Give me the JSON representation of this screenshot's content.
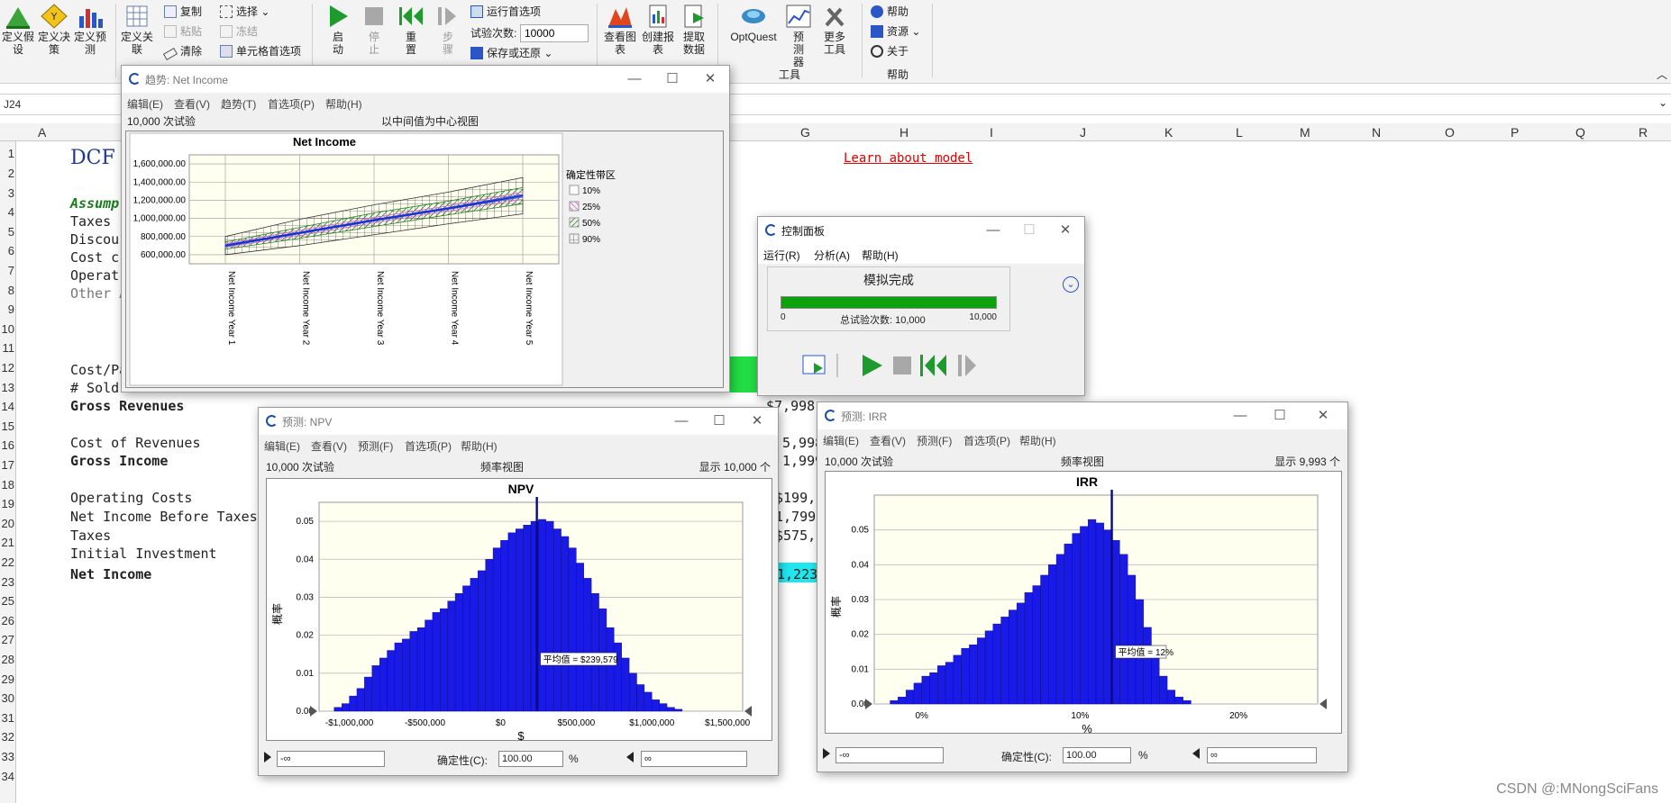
{
  "ribbon": {
    "define_assumption": "定义假设",
    "define_decision": "定义决策",
    "define_forecast": "定义预测",
    "define_correlation": "定义关联",
    "copy": "复制",
    "paste": "粘贴",
    "clear": "清除",
    "select": "选择",
    "freeze": "冻结",
    "cell_prefs": "单元格首选项",
    "start": "启动",
    "stop": "停止",
    "reset": "重置",
    "step": "步骤",
    "run_prefs": "运行首选项",
    "trials_label": "试验次数:",
    "trials_value": "10000",
    "save_restore": "保存或还原",
    "view_charts": "查看图表",
    "create_report": "创建报表",
    "extract_data": "提取数据",
    "optquest": "OptQuest",
    "predictor": "预测器",
    "more_tools": "更多工具",
    "tools_group": "工具",
    "help": "帮助",
    "resources": "资源",
    "about": "关于",
    "help_group": "帮助"
  },
  "formula_bar": {
    "name_box": "J24"
  },
  "columns": [
    "A",
    "G",
    "H",
    "I",
    "J",
    "K",
    "L",
    "M",
    "N",
    "O",
    "P",
    "Q",
    "R"
  ],
  "rows": [
    "1",
    "2",
    "3",
    "4",
    "5",
    "6",
    "7",
    "8",
    "9",
    "10",
    "11",
    "12",
    "13",
    "14",
    "15",
    "16",
    "17",
    "18",
    "19",
    "20",
    "21",
    "22",
    "23",
    "25",
    "26",
    "27",
    "28",
    "29",
    "30",
    "31",
    "32",
    "33",
    "34"
  ],
  "sheet": {
    "title": "DCF",
    "learn_link": "Learn about model",
    "assump": "Assump",
    "taxes": "Taxes",
    "discou": "Discou",
    "cost_c": "Cost c",
    "operat": "Operat",
    "other": "Other A",
    "cost_pa": "Cost/Pa",
    "sold": "# Sold",
    "gross_rev": "Gross Revenues",
    "cost_rev": "Cost of Revenues",
    "gross_income": "Gross Income",
    "op_costs": "Operating Costs",
    "nibt": "Net Income Before Taxes",
    "taxes2": "Taxes",
    "init_inv": "Initial Investment",
    "net_income": "Net Income",
    "g_rev": "$7,998,",
    "g_cost": "5,998,",
    "g_gross": "1,999,",
    "g_op": "$199,",
    "g_nibt": "1,799,",
    "g_tax": "$575,",
    "g_net": "1,223,"
  },
  "trend": {
    "title": "趋势: Net Income",
    "menus": [
      "编辑(E)",
      "查看(V)",
      "趋势(T)",
      "首选项(P)",
      "帮助(H)"
    ],
    "trials": "10,000 次试验",
    "view": "以中间值为中心视图",
    "chart_title": "Net Income",
    "legend_title": "确定性带区",
    "legend": [
      "10%",
      "25%",
      "50%",
      "90%"
    ]
  },
  "control": {
    "title": "控制面板",
    "menus": [
      "运行(R)",
      "分析(A)",
      "帮助(H)"
    ],
    "status": "模拟完成",
    "progress_min": "0",
    "progress_max": "10,000",
    "total_label": "总试验次数: 10,000",
    "progress": 1.0
  },
  "npv": {
    "title": "预测: NPV",
    "menus": [
      "编辑(E)",
      "查看(V)",
      "预测(F)",
      "首选项(P)",
      "帮助(H)"
    ],
    "trials": "10,000 次试验",
    "view": "频率视图",
    "shown": "显示 10,000 个",
    "chart_title": "NPV",
    "ylabel": "概率",
    "xlabel": "$",
    "mean_label": "平均值 = $239,579",
    "left_value": "-∞",
    "certainty_label": "确定性(C):",
    "certainty_value": "100.00",
    "pct": "%",
    "right_value": "∞"
  },
  "irr": {
    "title": "预测: IRR",
    "menus": [
      "编辑(E)",
      "查看(V)",
      "预测(F)",
      "首选项(P)",
      "帮助(H)"
    ],
    "trials": "10,000 次试验",
    "view": "频率视图",
    "shown": "显示 9,993 个",
    "chart_title": "IRR",
    "ylabel": "概率",
    "xlabel": "%",
    "mean_label": "平均值 = 12%",
    "left_value": "-∞",
    "certainty_label": "确定性(C):",
    "certainty_value": "100.00",
    "pct": "%",
    "right_value": "∞"
  },
  "chart_data": [
    {
      "type": "line",
      "title": "Net Income",
      "categories": [
        "Net Income Year 1",
        "Net Income Year 2",
        "Net Income Year 3",
        "Net Income Year 4",
        "Net Income Year 5"
      ],
      "yticks": [
        "600,000.00",
        "800,000.00",
        "1,000,000.00",
        "1,200,000.00",
        "1,400,000.00",
        "1,600,000.00"
      ],
      "ylim": [
        500000,
        1700000
      ],
      "series": [
        {
          "values": [
            700000,
            840000,
            980000,
            1110000,
            1250000
          ]
        }
      ],
      "bands": [
        {
          "name": "90%",
          "low": [
            600000,
            700000,
            820000,
            940000,
            1050000
          ],
          "high": [
            800000,
            990000,
            1150000,
            1290000,
            1450000
          ]
        },
        {
          "name": "50%",
          "low": [
            660000,
            780000,
            910000,
            1040000,
            1160000
          ],
          "high": [
            740000,
            900000,
            1060000,
            1190000,
            1340000
          ]
        },
        {
          "name": "25%",
          "low": [
            680000,
            810000,
            950000,
            1080000,
            1210000
          ],
          "high": [
            720000,
            870000,
            1010000,
            1140000,
            1290000
          ]
        },
        {
          "name": "10%",
          "low": [
            690000,
            830000,
            970000,
            1100000,
            1235000
          ],
          "high": [
            710000,
            850000,
            990000,
            1120000,
            1265000
          ]
        }
      ],
      "legend": "right",
      "grid": true
    },
    {
      "type": "bar",
      "title": "NPV",
      "xlabel": "$",
      "ylabel": "概率",
      "xlim": [
        -1200000,
        1600000
      ],
      "ylim": [
        0,
        0.055
      ],
      "xticks": [
        "-$1,000,000",
        "-$500,000",
        "$0",
        "$500,000",
        "$1,000,000",
        "$1,500,000"
      ],
      "yticks": [
        "0.00",
        "0.01",
        "0.02",
        "0.03",
        "0.04",
        "0.05"
      ],
      "bin_start": -1100000,
      "bin_width": 50000,
      "values": [
        0.001,
        0.002,
        0.004,
        0.006,
        0.009,
        0.012,
        0.014,
        0.016,
        0.018,
        0.019,
        0.021,
        0.022,
        0.024,
        0.026,
        0.027,
        0.029,
        0.031,
        0.033,
        0.035,
        0.037,
        0.04,
        0.043,
        0.045,
        0.047,
        0.048,
        0.049,
        0.05,
        0.0505,
        0.05,
        0.048,
        0.046,
        0.043,
        0.039,
        0.035,
        0.031,
        0.027,
        0.022,
        0.018,
        0.014,
        0.01,
        0.007,
        0.005,
        0.003,
        0.002,
        0.001,
        0.0005
      ],
      "mean": 239579
    },
    {
      "type": "bar",
      "title": "IRR",
      "xlabel": "%",
      "ylabel": "概率",
      "xlim": [
        -0.03,
        0.25
      ],
      "ylim": [
        0,
        0.06
      ],
      "xticks": [
        "0%",
        "10%",
        "20%"
      ],
      "yticks": [
        "0.00",
        "0.01",
        "0.02",
        "0.03",
        "0.04",
        "0.05"
      ],
      "bin_start": -0.02,
      "bin_width": 0.005,
      "values": [
        0.001,
        0.002,
        0.004,
        0.006,
        0.008,
        0.009,
        0.011,
        0.012,
        0.014,
        0.016,
        0.017,
        0.019,
        0.021,
        0.023,
        0.025,
        0.027,
        0.029,
        0.032,
        0.034,
        0.037,
        0.04,
        0.043,
        0.046,
        0.049,
        0.051,
        0.053,
        0.052,
        0.05,
        0.047,
        0.043,
        0.037,
        0.03,
        0.022,
        0.014,
        0.008,
        0.004,
        0.002,
        0.001
      ],
      "mean": 0.12
    }
  ],
  "watermark": "CSDN @:MNongSciFans"
}
